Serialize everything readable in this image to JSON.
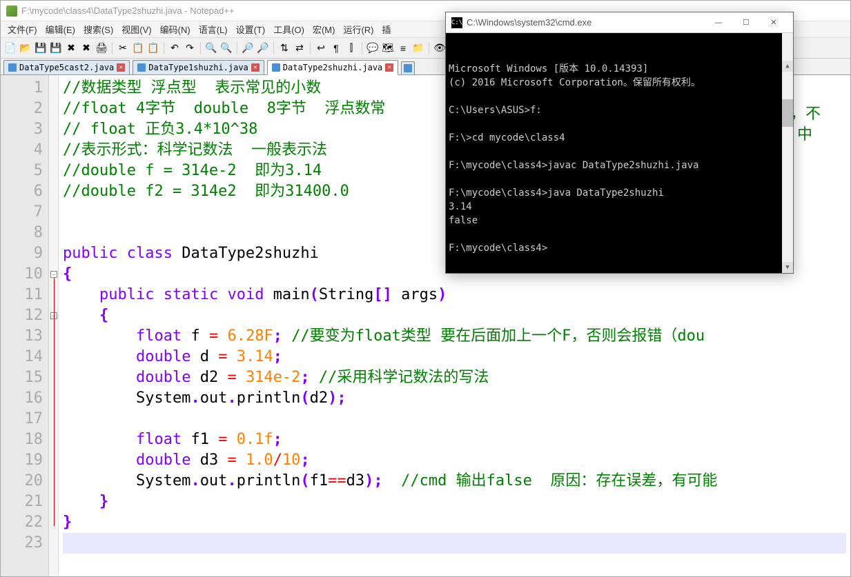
{
  "npp": {
    "title": "F:\\mycode\\class4\\DataType2shuzhi.java - Notepad++",
    "menu": [
      "文件(F)",
      "编辑(E)",
      "搜索(S)",
      "视图(V)",
      "编码(N)",
      "语言(L)",
      "设置(T)",
      "工具(O)",
      "宏(M)",
      "运行(R)",
      "插"
    ],
    "toolbar_icons": [
      "new-file-icon",
      "open-file-icon",
      "save-icon",
      "save-all-icon",
      "close-icon",
      "close-all-icon",
      "print-icon",
      "sep",
      "cut-icon",
      "copy-icon",
      "paste-icon",
      "sep",
      "undo-icon",
      "redo-icon",
      "sep",
      "find-icon",
      "replace-icon",
      "sep",
      "zoom-in-icon",
      "zoom-out-icon",
      "sep",
      "sync-v-icon",
      "sync-h-icon",
      "sep",
      "wordwrap-icon",
      "all-chars-icon",
      "indent-guide-icon",
      "sep",
      "lang-icon",
      "doc-map-icon",
      "func-list-icon",
      "folder-icon",
      "sep",
      "monitor-icon",
      "record-icon",
      "play-icon",
      "sep",
      "stop-icon",
      "play2-icon"
    ],
    "tabs": [
      {
        "label": "DataType5cast2.java",
        "active": false
      },
      {
        "label": "DataType1shuzhi.java",
        "active": false
      },
      {
        "label": "DataType2shuzhi.java",
        "active": true
      }
    ]
  },
  "code": {
    "lines": [
      {
        "n": 1,
        "t": "comment",
        "text": "//数据类型 浮点型  表示常见的小数"
      },
      {
        "n": 2,
        "t": "comment",
        "text": "//float 4字节  double  8字节  浮点数常"
      },
      {
        "n": 3,
        "t": "comment",
        "text": "// float 正负3.4*10^38"
      },
      {
        "n": 4,
        "t": "comment",
        "text": "//表示形式：科学记数法  一般表示法"
      },
      {
        "n": 5,
        "t": "comment",
        "text": "//double f = 314e-2  即为3.14"
      },
      {
        "n": 6,
        "t": "comment",
        "text": "//double f2 = 314e2  即为31400.0"
      },
      {
        "n": 7,
        "t": "blank",
        "text": ""
      },
      {
        "n": 8,
        "t": "blank",
        "text": ""
      },
      {
        "n": 9,
        "t": "code",
        "tokens": [
          {
            "c": "keyword",
            "s": "public"
          },
          {
            "c": "text",
            "s": " "
          },
          {
            "c": "keyword",
            "s": "class"
          },
          {
            "c": "text",
            "s": " DataType2shuzhi"
          }
        ]
      },
      {
        "n": 10,
        "t": "code",
        "tokens": [
          {
            "c": "paren",
            "s": "{"
          }
        ],
        "fold": "open"
      },
      {
        "n": 11,
        "t": "code",
        "tokens": [
          {
            "c": "text",
            "s": "    "
          },
          {
            "c": "keyword",
            "s": "public"
          },
          {
            "c": "text",
            "s": " "
          },
          {
            "c": "keyword",
            "s": "static"
          },
          {
            "c": "text",
            "s": " "
          },
          {
            "c": "keyword",
            "s": "void"
          },
          {
            "c": "text",
            "s": " main"
          },
          {
            "c": "paren",
            "s": "("
          },
          {
            "c": "text",
            "s": "String"
          },
          {
            "c": "paren",
            "s": "[]"
          },
          {
            "c": "text",
            "s": " args"
          },
          {
            "c": "paren",
            "s": ")"
          }
        ]
      },
      {
        "n": 12,
        "t": "code",
        "tokens": [
          {
            "c": "text",
            "s": "    "
          },
          {
            "c": "paren",
            "s": "{"
          }
        ],
        "fold": "open"
      },
      {
        "n": 13,
        "t": "code",
        "tokens": [
          {
            "c": "text",
            "s": "        "
          },
          {
            "c": "keyword",
            "s": "float"
          },
          {
            "c": "text",
            "s": " f "
          },
          {
            "c": "op",
            "s": "="
          },
          {
            "c": "text",
            "s": " "
          },
          {
            "c": "number",
            "s": "6.28F"
          },
          {
            "c": "paren",
            "s": ";"
          },
          {
            "c": "text",
            "s": " "
          },
          {
            "c": "comment",
            "s": "//要变为float类型 要在后面加上一个F，否则会报错（dou"
          }
        ]
      },
      {
        "n": 14,
        "t": "code",
        "tokens": [
          {
            "c": "text",
            "s": "        "
          },
          {
            "c": "keyword",
            "s": "double"
          },
          {
            "c": "text",
            "s": " d "
          },
          {
            "c": "op",
            "s": "="
          },
          {
            "c": "text",
            "s": " "
          },
          {
            "c": "number",
            "s": "3.14"
          },
          {
            "c": "paren",
            "s": ";"
          }
        ]
      },
      {
        "n": 15,
        "t": "code",
        "tokens": [
          {
            "c": "text",
            "s": "        "
          },
          {
            "c": "keyword",
            "s": "double"
          },
          {
            "c": "text",
            "s": " d2 "
          },
          {
            "c": "op",
            "s": "="
          },
          {
            "c": "text",
            "s": " "
          },
          {
            "c": "number",
            "s": "314e-2"
          },
          {
            "c": "paren",
            "s": ";"
          },
          {
            "c": "text",
            "s": " "
          },
          {
            "c": "comment",
            "s": "//采用科学记数法的写法"
          }
        ]
      },
      {
        "n": 16,
        "t": "code",
        "tokens": [
          {
            "c": "text",
            "s": "        System"
          },
          {
            "c": "paren",
            "s": "."
          },
          {
            "c": "text",
            "s": "out"
          },
          {
            "c": "paren",
            "s": "."
          },
          {
            "c": "text",
            "s": "println"
          },
          {
            "c": "paren",
            "s": "("
          },
          {
            "c": "text",
            "s": "d2"
          },
          {
            "c": "paren",
            "s": ");"
          }
        ]
      },
      {
        "n": 17,
        "t": "blank",
        "text": ""
      },
      {
        "n": 18,
        "t": "code",
        "tokens": [
          {
            "c": "text",
            "s": "        "
          },
          {
            "c": "keyword",
            "s": "float"
          },
          {
            "c": "text",
            "s": " f1 "
          },
          {
            "c": "op",
            "s": "="
          },
          {
            "c": "text",
            "s": " "
          },
          {
            "c": "number",
            "s": "0.1f"
          },
          {
            "c": "paren",
            "s": ";"
          }
        ]
      },
      {
        "n": 19,
        "t": "code",
        "tokens": [
          {
            "c": "text",
            "s": "        "
          },
          {
            "c": "keyword",
            "s": "double"
          },
          {
            "c": "text",
            "s": " d3 "
          },
          {
            "c": "op",
            "s": "="
          },
          {
            "c": "text",
            "s": " "
          },
          {
            "c": "number",
            "s": "1.0"
          },
          {
            "c": "op",
            "s": "/"
          },
          {
            "c": "number",
            "s": "10"
          },
          {
            "c": "paren",
            "s": ";"
          }
        ]
      },
      {
        "n": 20,
        "t": "code",
        "tokens": [
          {
            "c": "text",
            "s": "        System"
          },
          {
            "c": "paren",
            "s": "."
          },
          {
            "c": "text",
            "s": "out"
          },
          {
            "c": "paren",
            "s": "."
          },
          {
            "c": "text",
            "s": "println"
          },
          {
            "c": "paren",
            "s": "("
          },
          {
            "c": "text",
            "s": "f1"
          },
          {
            "c": "op",
            "s": "=="
          },
          {
            "c": "text",
            "s": "d3"
          },
          {
            "c": "paren",
            "s": ");"
          },
          {
            "c": "text",
            "s": "  "
          },
          {
            "c": "comment",
            "s": "//cmd 输出false  原因：存在误差，有可能"
          }
        ]
      },
      {
        "n": 21,
        "t": "code",
        "tokens": [
          {
            "c": "text",
            "s": "    "
          },
          {
            "c": "paren",
            "s": "}"
          }
        ]
      },
      {
        "n": 22,
        "t": "code",
        "tokens": [
          {
            "c": "paren",
            "s": "}"
          }
        ]
      },
      {
        "n": 23,
        "t": "blank",
        "text": "",
        "highlight": true
      }
    ]
  },
  "hidden": {
    "line2_tail": "，不",
    "line3_tail": "中"
  },
  "cmd": {
    "title": "C:\\Windows\\system32\\cmd.exe",
    "icon_text": "C:\\",
    "lines": [
      "Microsoft Windows [版本 10.0.14393]",
      "(c) 2016 Microsoft Corporation。保留所有权利。",
      "",
      "C:\\Users\\ASUS>f:",
      "",
      "F:\\>cd mycode\\class4",
      "",
      "F:\\mycode\\class4>javac DataType2shuzhi.java",
      "",
      "F:\\mycode\\class4>java DataType2shuzhi",
      "3.14",
      "false",
      "",
      "F:\\mycode\\class4>"
    ],
    "btns": {
      "min": "—",
      "max": "☐",
      "close": "✕"
    }
  }
}
